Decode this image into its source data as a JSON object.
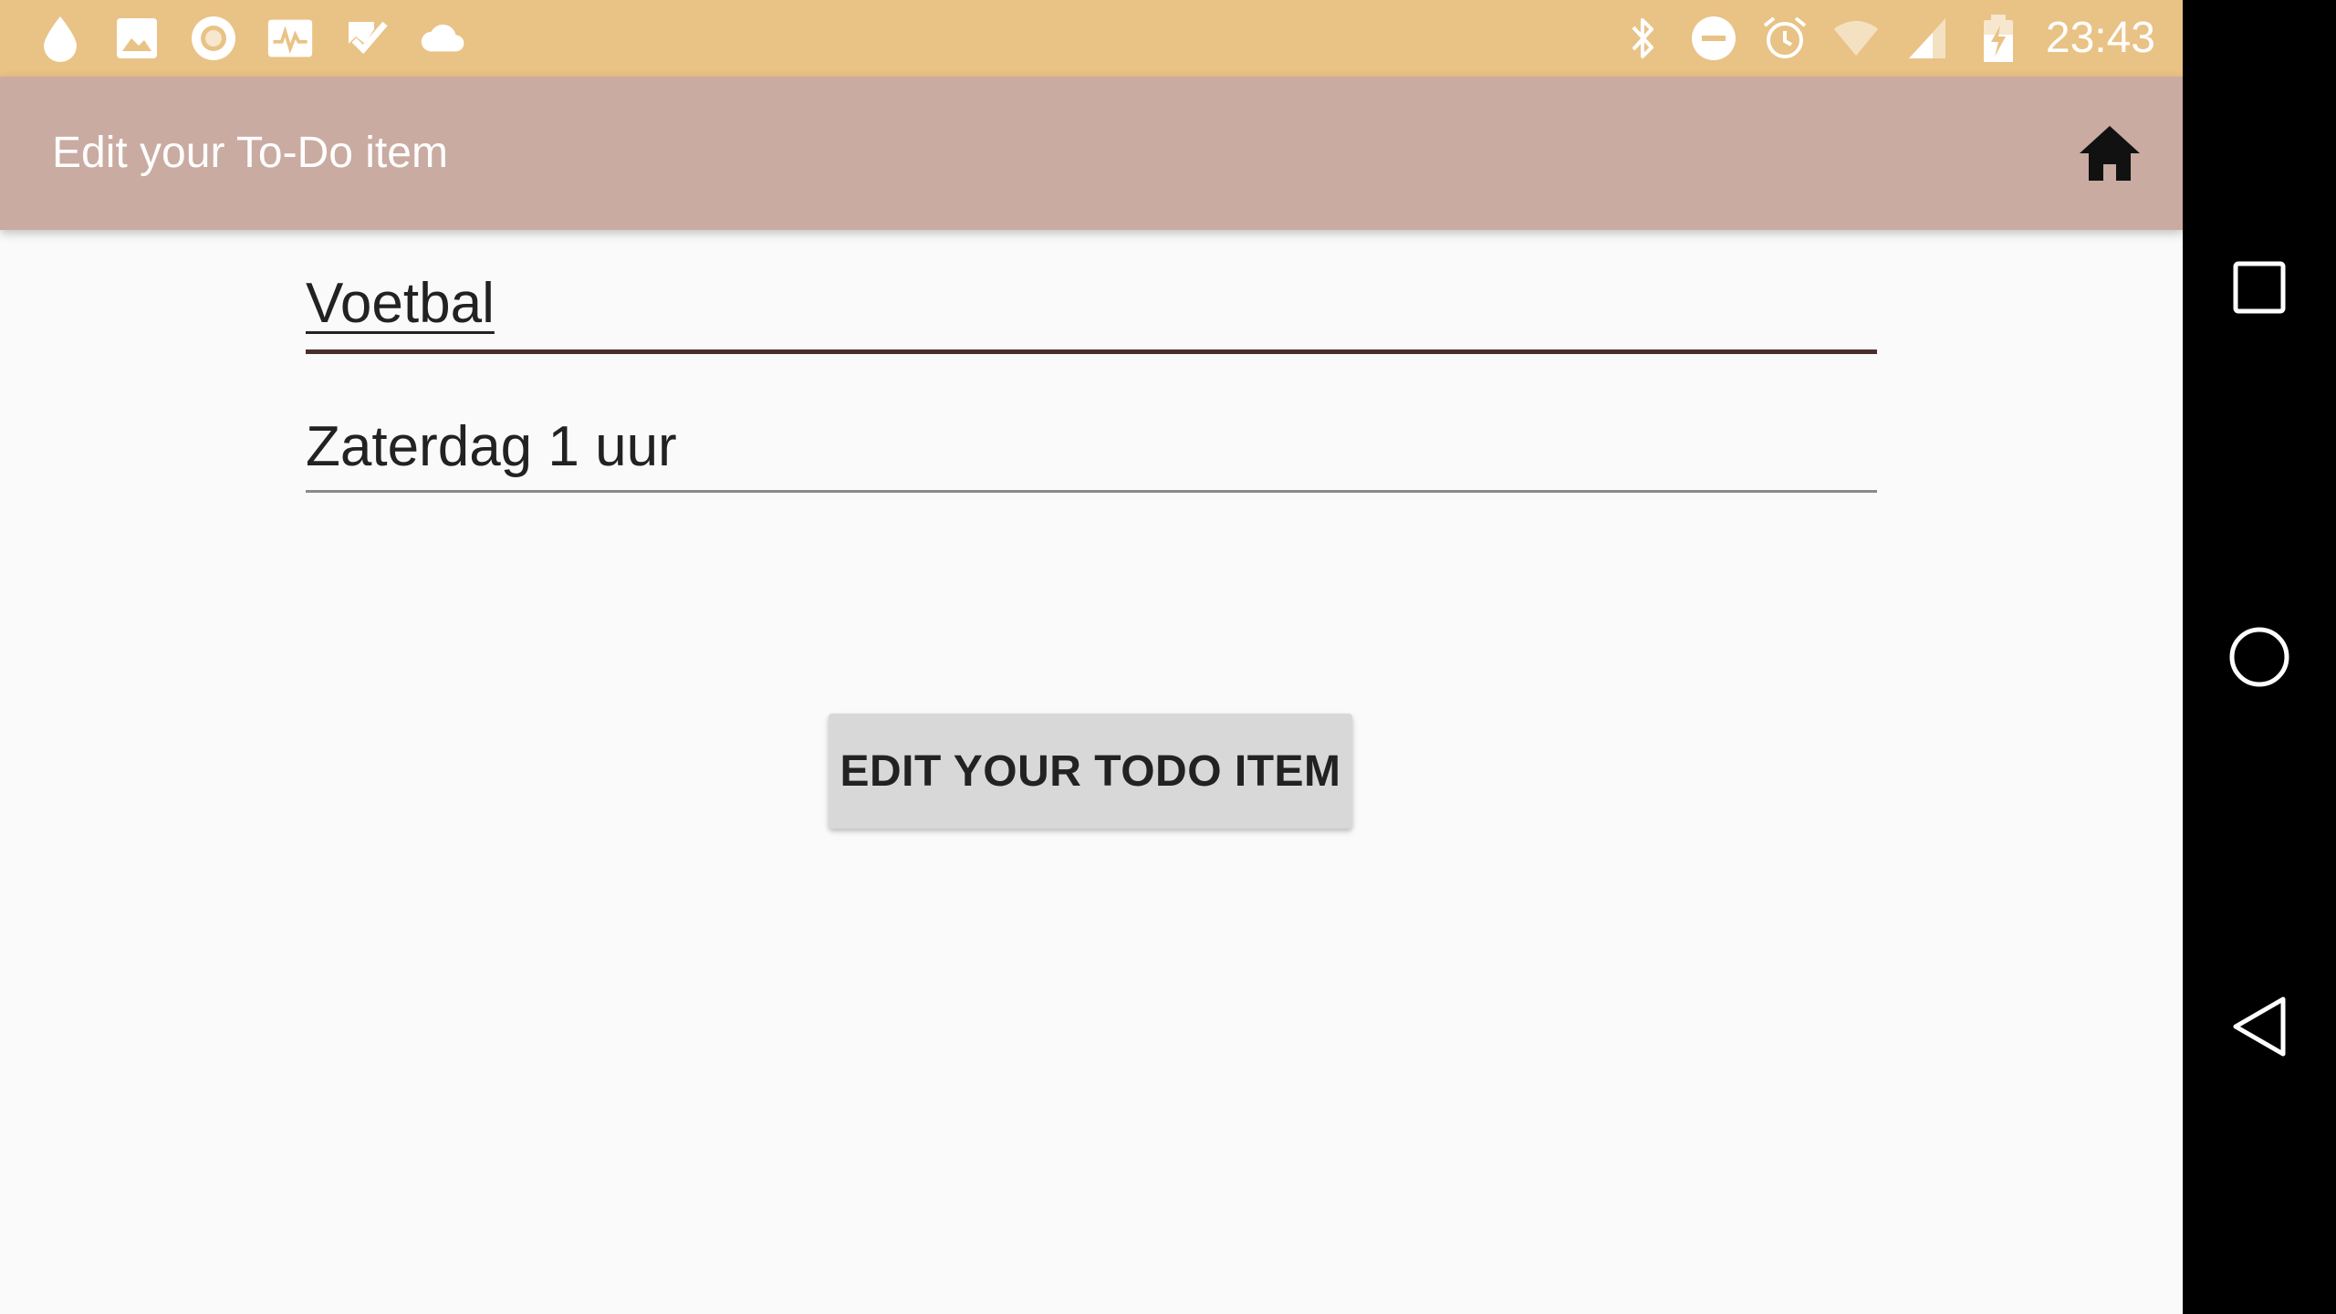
{
  "status_bar": {
    "time": "23:43",
    "left_icons": [
      "drop-icon",
      "image-icon",
      "circle-record-icon",
      "activity-icon",
      "checkmark-icon",
      "cloud-icon"
    ],
    "right_icons": [
      "bluetooth-icon",
      "do-not-disturb-icon",
      "alarm-icon",
      "wifi-icon",
      "signal-icon",
      "battery-icon"
    ]
  },
  "app_bar": {
    "title": "Edit your To-Do item",
    "home_icon": "home-icon"
  },
  "form": {
    "title_value": "Voetbal",
    "description_value": "Zaterdag 1 uur",
    "submit_label": "EDIT YOUR TODO ITEM"
  },
  "nav_bar": {
    "buttons": [
      "recents-icon",
      "home-circle-icon",
      "back-icon"
    ]
  },
  "colors": {
    "status_bar": "#e9c285",
    "app_bar": "#c9aba1",
    "background": "#fafafa",
    "accent": "#4a2e2e",
    "button": "#d8d8d8"
  }
}
